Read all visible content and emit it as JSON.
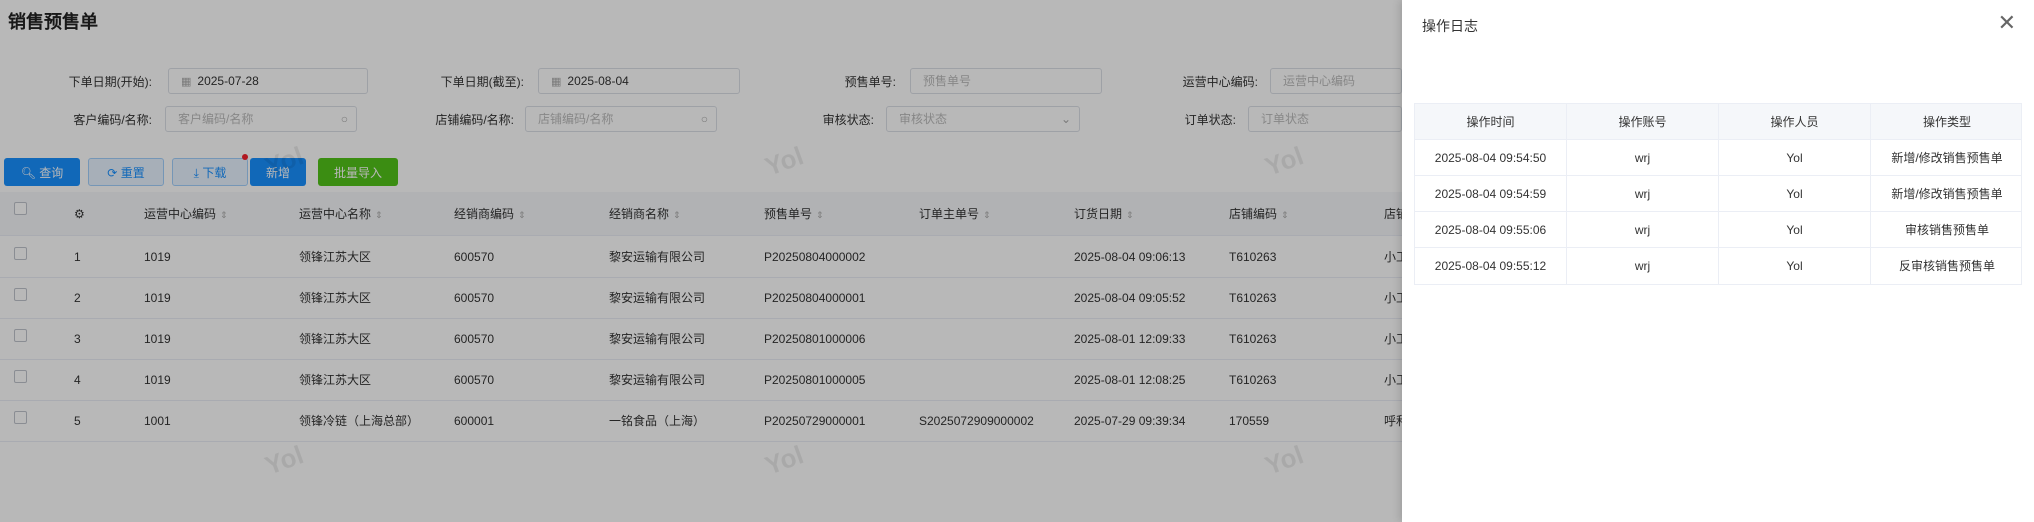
{
  "page": {
    "title": "销售预售单"
  },
  "filters": {
    "order_date_start_label": "下单日期(开始):",
    "order_date_start_value": "2025-07-28",
    "order_date_end_label": "下单日期(截至):",
    "order_date_end_value": "2025-08-04",
    "presale_no_label": "预售单号:",
    "presale_no_placeholder": "预售单号",
    "ops_center_code_label": "运营中心编码:",
    "ops_center_code_placeholder": "运营中心编码",
    "customer_label": "客户编码/名称:",
    "customer_placeholder": "客户编码/名称",
    "store_label": "店铺编码/名称:",
    "store_placeholder": "店铺编码/名称",
    "audit_label": "审核状态:",
    "audit_placeholder": "审核状态",
    "order_status_label": "订单状态:",
    "order_status_placeholder": "订单状态"
  },
  "toolbar": {
    "query": "查询",
    "reset": "重置",
    "download": "下载",
    "add": "新增",
    "batch_import": "批量导入"
  },
  "table": {
    "headers": [
      "运营中心编码",
      "运营中心名称",
      "经销商编码",
      "经销商名称",
      "预售单号",
      "订单主单号",
      "订货日期",
      "店铺编码",
      "店铺"
    ],
    "rows": [
      {
        "idx": "1",
        "center_code": "1019",
        "center_name": "领锋江苏大区",
        "dealer_code": "600570",
        "dealer_name": "黎安运输有限公司",
        "presale_no": "P20250804000002",
        "main_no": "",
        "order_date": "2025-08-04 09:06:13",
        "store_code": "T610263",
        "store": "小工"
      },
      {
        "idx": "2",
        "center_code": "1019",
        "center_name": "领锋江苏大区",
        "dealer_code": "600570",
        "dealer_name": "黎安运输有限公司",
        "presale_no": "P20250804000001",
        "main_no": "",
        "order_date": "2025-08-04 09:05:52",
        "store_code": "T610263",
        "store": "小工"
      },
      {
        "idx": "3",
        "center_code": "1019",
        "center_name": "领锋江苏大区",
        "dealer_code": "600570",
        "dealer_name": "黎安运输有限公司",
        "presale_no": "P20250801000006",
        "main_no": "",
        "order_date": "2025-08-01 12:09:33",
        "store_code": "T610263",
        "store": "小工"
      },
      {
        "idx": "4",
        "center_code": "1019",
        "center_name": "领锋江苏大区",
        "dealer_code": "600570",
        "dealer_name": "黎安运输有限公司",
        "presale_no": "P20250801000005",
        "main_no": "",
        "order_date": "2025-08-01 12:08:25",
        "store_code": "T610263",
        "store": "小工"
      },
      {
        "idx": "5",
        "center_code": "1001",
        "center_name": "领锋冷链（上海总部）",
        "dealer_code": "600001",
        "dealer_name": "一铭食品（上海）",
        "presale_no": "P20250729000001",
        "main_no": "S2025072909000002",
        "order_date": "2025-07-29 09:39:34",
        "store_code": "170559",
        "store": "呼和"
      }
    ]
  },
  "watermark": "Yol",
  "drawer": {
    "title": "操作日志",
    "close_icon": "close-icon",
    "headers": [
      "操作时间",
      "操作账号",
      "操作人员",
      "操作类型"
    ],
    "rows": [
      {
        "time": "2025-08-04 09:54:50",
        "account": "wrj",
        "person": "Yol",
        "type": "新增/修改销售预售单"
      },
      {
        "time": "2025-08-04 09:54:59",
        "account": "wrj",
        "person": "Yol",
        "type": "新增/修改销售预售单"
      },
      {
        "time": "2025-08-04 09:55:06",
        "account": "wrj",
        "person": "Yol",
        "type": "审核销售预售单"
      },
      {
        "time": "2025-08-04 09:55:12",
        "account": "wrj",
        "person": "Yol",
        "type": "反审核销售预售单"
      }
    ]
  },
  "colors": {
    "primary": "#1890ff",
    "success": "#52c41a",
    "overlay": "rgba(0,0,0,0.28)"
  }
}
